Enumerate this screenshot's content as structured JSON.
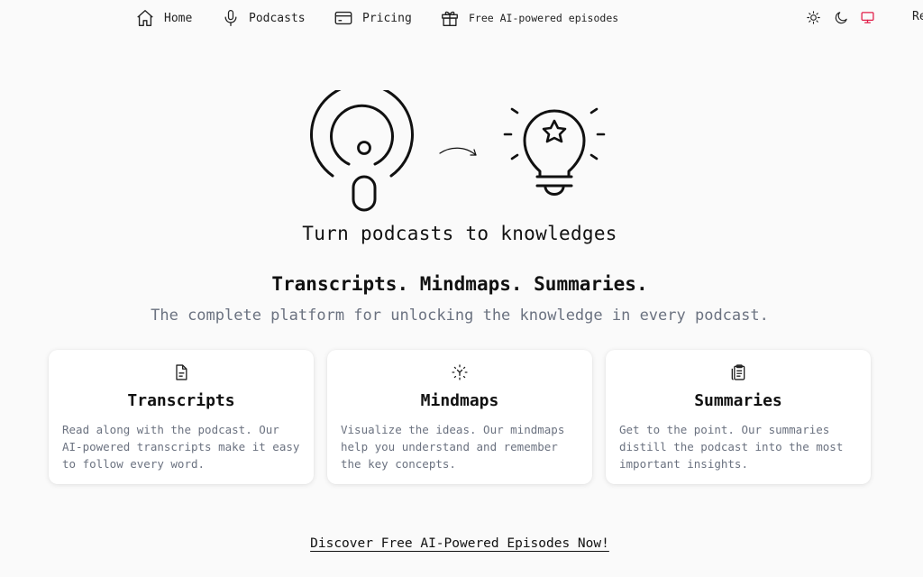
{
  "nav": {
    "items": [
      {
        "label": "Home",
        "icon": "home-icon"
      },
      {
        "label": "Podcasts",
        "icon": "microphone-icon"
      },
      {
        "label": "Pricing",
        "icon": "credit-card-icon"
      },
      {
        "label": "Free AI-powered episodes",
        "icon": "gift-icon"
      }
    ],
    "theme_icons": [
      "sun-icon",
      "moon-icon",
      "monitor-icon"
    ],
    "cut_off_text": "Re"
  },
  "hero": {
    "tagline": "Turn podcasts to knowledges",
    "headline": "Transcripts. Mindmaps. Summaries.",
    "subhead": "The complete platform for unlocking the knowledge in every podcast."
  },
  "features": [
    {
      "title": "Transcripts",
      "icon": "document-icon",
      "description": "Read along with the podcast. Our AI-powered transcripts make it easy to follow every word."
    },
    {
      "title": "Mindmaps",
      "icon": "mindmap-icon",
      "description": "Visualize the ideas. Our mindmaps help you understand and remember the key concepts."
    },
    {
      "title": "Summaries",
      "icon": "clipboard-icon",
      "description": "Get to the point. Our summaries distill the podcast into the most important insights."
    }
  ],
  "cta": {
    "label": "Discover Free AI-Powered Episodes Now!"
  },
  "colors": {
    "background": "#fafafa",
    "text": "#111111",
    "muted": "#6b7280",
    "active_theme": "#e11d48"
  }
}
